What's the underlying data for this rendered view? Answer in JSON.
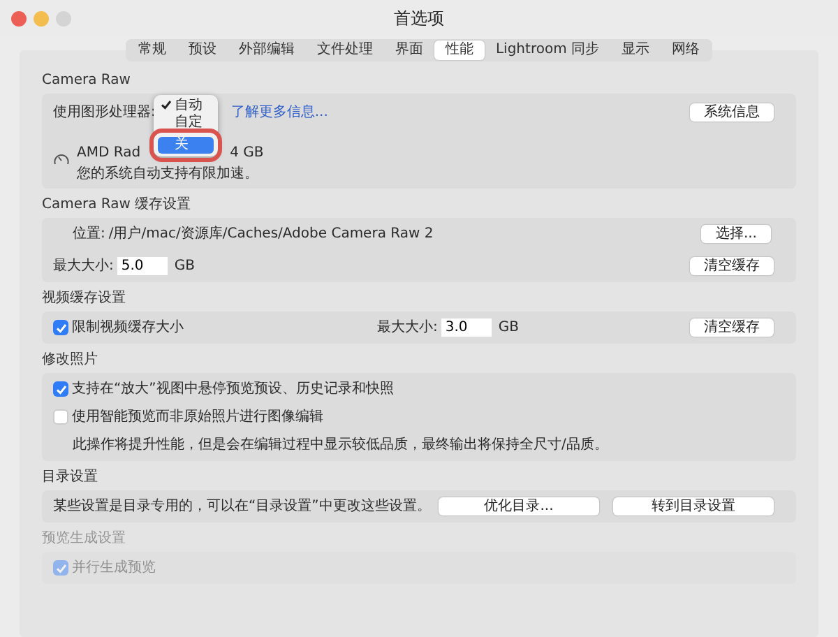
{
  "window": {
    "title": "首选项"
  },
  "tabs": [
    {
      "label": "常规",
      "selected": false
    },
    {
      "label": "预设",
      "selected": false
    },
    {
      "label": "外部编辑",
      "selected": false
    },
    {
      "label": "文件处理",
      "selected": false
    },
    {
      "label": "界面",
      "selected": false
    },
    {
      "label": "性能",
      "selected": true
    },
    {
      "label": "Lightroom 同步",
      "selected": false
    },
    {
      "label": "显示",
      "selected": false
    },
    {
      "label": "网络",
      "selected": false
    }
  ],
  "camera_raw": {
    "heading": "Camera Raw",
    "gpu_label": "使用图形处理器:",
    "learn_more_link": "了解更多信息...",
    "system_info_button": "系统信息",
    "gpu_name": "AMD Rad",
    "gpu_memory": "4 GB",
    "note": "您的系统自动支持有限加速。",
    "gpu_menu": [
      {
        "label": "自动",
        "checked": true,
        "selected": false,
        "circled": false
      },
      {
        "label": "自定",
        "checked": false,
        "selected": false,
        "circled": false
      },
      {
        "label": "关",
        "checked": false,
        "selected": true,
        "circled": true
      }
    ]
  },
  "cache": {
    "heading": "Camera Raw 缓存设置",
    "location_label": "位置:",
    "location": "/用户/mac/资源库/Caches/Adobe Camera Raw 2",
    "choose_button": "选择...",
    "max_size_label": "最大大小:",
    "max_size": "5.0",
    "unit": "GB",
    "clear_button": "清空缓存"
  },
  "video_cache": {
    "heading": "视频缓存设置",
    "limit_label": "限制视频缓存大小",
    "limit_checked": true,
    "max_size_label": "最大大小:",
    "max_size": "3.0",
    "unit": "GB",
    "clear_button": "清空缓存"
  },
  "develop": {
    "heading": "修改照片",
    "options": [
      {
        "label": "支持在“放大”视图中悬停预览预设、历史记录和快照",
        "checked": true
      },
      {
        "label": "使用智能预览而非原始照片进行图像编辑",
        "checked": false
      }
    ],
    "note": "此操作将提升性能，但是会在编辑过程中显示较低品质，最终输出将保持全尺寸/品质。"
  },
  "catalog": {
    "heading": "目录设置",
    "text": "某些设置是目录专用的，可以在“目录设置”中更改这些设置。",
    "buttons": [
      "优化目录...",
      "转到目录设置"
    ]
  },
  "preview": {
    "heading": "预览生成设置",
    "option": {
      "label": "并行生成预览",
      "checked": true
    }
  }
}
